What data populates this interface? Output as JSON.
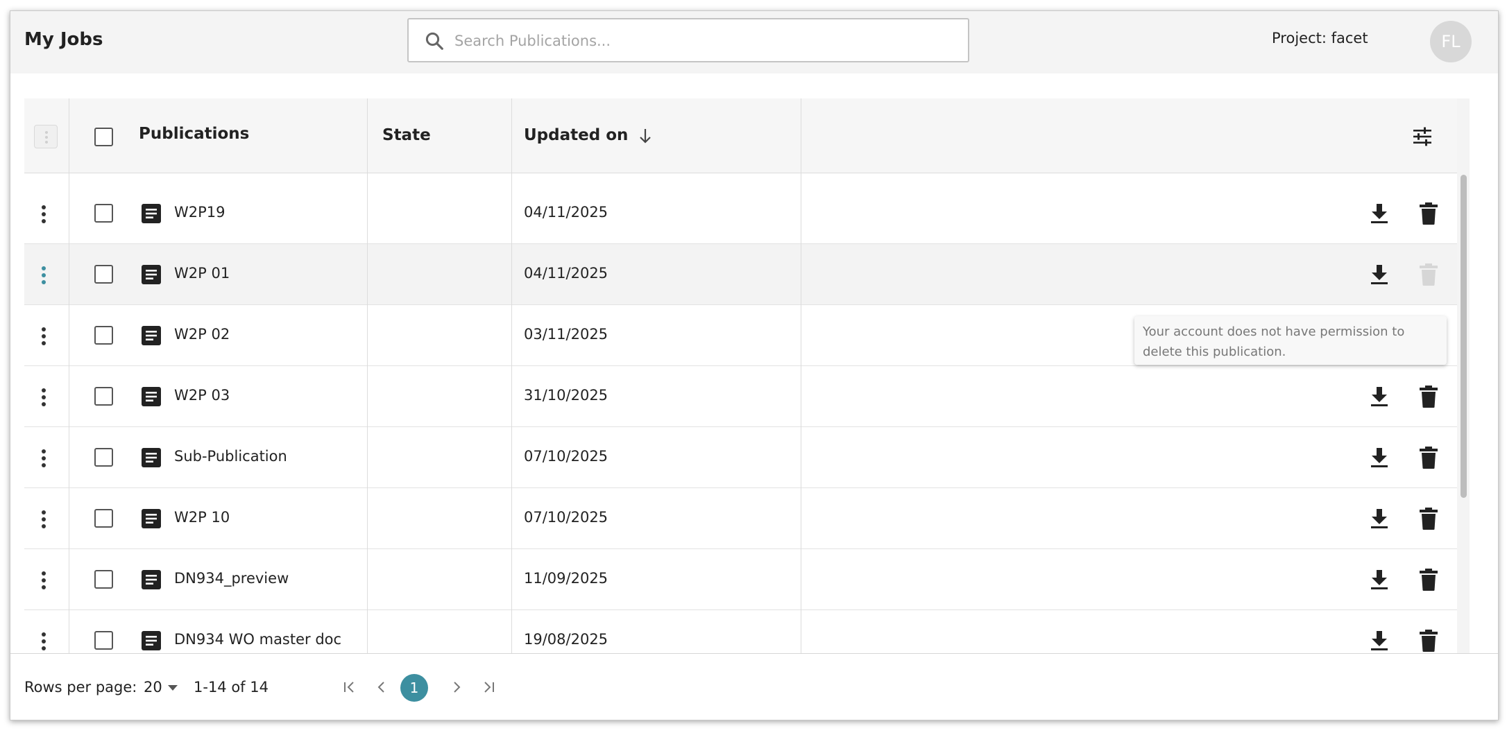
{
  "header": {
    "title": "My Jobs",
    "search_placeholder": "Search Publications...",
    "project_label": "Project: facet",
    "avatar_initials": "FL"
  },
  "table": {
    "columns": {
      "publications": "Publications",
      "state": "State",
      "updated_on": "Updated on"
    },
    "sort": {
      "column": "updated_on",
      "direction": "descending",
      "icon": "arrow-down-icon"
    },
    "rows": [
      {
        "name": "W2P19",
        "state": "",
        "updated_on": "04/11/2025",
        "delete_enabled": true
      },
      {
        "name": "W2P 01",
        "state": "",
        "updated_on": "04/11/2025",
        "delete_enabled": false
      },
      {
        "name": "W2P 02",
        "state": "",
        "updated_on": "03/11/2025",
        "delete_enabled": true
      },
      {
        "name": "W2P 03",
        "state": "",
        "updated_on": "31/10/2025",
        "delete_enabled": true
      },
      {
        "name": "Sub-Publication",
        "state": "",
        "updated_on": "07/10/2025",
        "delete_enabled": true
      },
      {
        "name": "W2P 10",
        "state": "",
        "updated_on": "07/10/2025",
        "delete_enabled": true
      },
      {
        "name": "DN934_preview",
        "state": "",
        "updated_on": "11/09/2025",
        "delete_enabled": true
      },
      {
        "name": "DN934 WO master doc",
        "state": "",
        "updated_on": "19/08/2025",
        "delete_enabled": true
      }
    ]
  },
  "tooltip": {
    "text": "Your account does not have permission to delete this publication."
  },
  "footer": {
    "rows_per_page_label": "Rows per page:",
    "rows_per_page_value": "20",
    "range": "1-14 of 14",
    "current_page": "1"
  },
  "colors": {
    "accent": "#3d8fa0",
    "header_bg": "#f4f4f4",
    "disabled_icon": "#d6d6d6"
  }
}
